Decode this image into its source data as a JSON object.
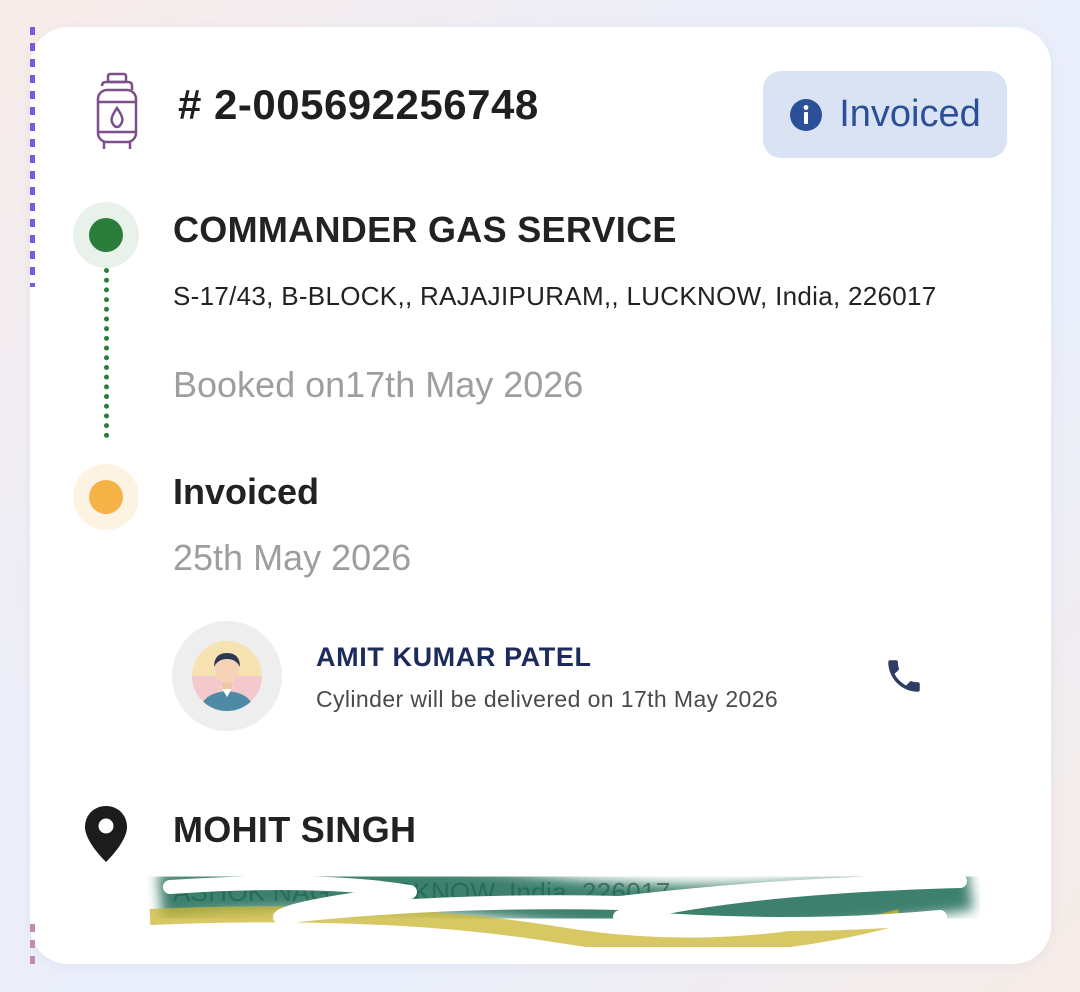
{
  "order": {
    "id": "# 2-005692256748",
    "status_label": "Invoiced",
    "status_icon": "info-icon",
    "cylinder_icon": "gas-cylinder-icon"
  },
  "distributor": {
    "name": "COMMANDER GAS SERVICE",
    "address": "S-17/43, B-BLOCK,, RAJAJIPURAM,, LUCKNOW, India, 226017",
    "booked": "Booked on17th May 2026"
  },
  "invoice": {
    "title": "Invoiced",
    "date": "25th May 2026"
  },
  "delivery_agent": {
    "name": "AMIT KUMAR PATEL",
    "note": "Cylinder will be delivered on 17th May 2026",
    "call_icon": "phone-icon"
  },
  "customer": {
    "name": "MOHIT SINGH",
    "address_visible": "ASHOK NAG...  LUCKNOW, India, 226017"
  },
  "colors": {
    "step_done": "#2a7d3a",
    "step_current": "#f4b247",
    "status_pill_bg": "#d9e3f3",
    "status_pill_text": "#2c4f9a",
    "agent_name": "#1d2a5c"
  }
}
